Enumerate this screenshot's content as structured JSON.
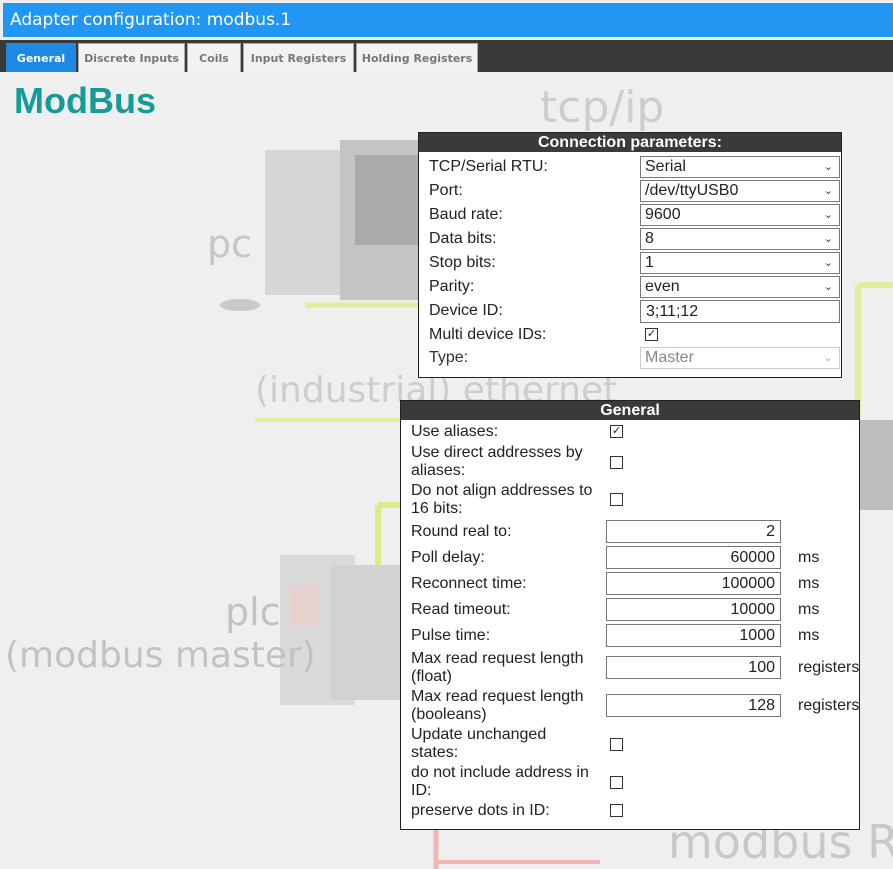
{
  "window": {
    "title": "Adapter configuration: modbus.1"
  },
  "tabs": [
    {
      "label": "General",
      "active": true
    },
    {
      "label": "Discrete Inputs",
      "active": false
    },
    {
      "label": "Coils",
      "active": false
    },
    {
      "label": "Input Registers",
      "active": false
    },
    {
      "label": "Holding Registers",
      "active": false
    }
  ],
  "brand": "ModBus",
  "background_labels": {
    "tcpip": "tcp/ip",
    "pc": "pc",
    "ethernet": "(industrial) ethernet",
    "plc": "plc",
    "master": "(modbus master)",
    "slave_partial": "modbus R"
  },
  "connection": {
    "title": "Connection parameters:",
    "tcp_serial": {
      "label": "TCP/Serial RTU:",
      "value": "Serial"
    },
    "port": {
      "label": "Port:",
      "value": "/dev/ttyUSB0"
    },
    "baud": {
      "label": "Baud rate:",
      "value": "9600"
    },
    "data_bits": {
      "label": "Data bits:",
      "value": "8"
    },
    "stop_bits": {
      "label": "Stop bits:",
      "value": "1"
    },
    "parity": {
      "label": "Parity:",
      "value": "even"
    },
    "device_id": {
      "label": "Device ID:",
      "value": "3;11;12"
    },
    "multi_ids": {
      "label": "Multi device IDs:",
      "checked": true
    },
    "type": {
      "label": "Type:",
      "value": "Master"
    }
  },
  "general": {
    "title": "General",
    "use_aliases": {
      "label": "Use aliases:",
      "checked": true
    },
    "direct_addresses": {
      "label1": "Use direct addresses by",
      "label2": "aliases:",
      "checked": false
    },
    "no_align": {
      "label1": "Do not align addresses to",
      "label2": "16 bits:",
      "checked": false
    },
    "round_real": {
      "label": "Round real to:",
      "value": "2"
    },
    "poll_delay": {
      "label": "Poll delay:",
      "value": "60000",
      "unit": "ms"
    },
    "reconnect": {
      "label": "Reconnect time:",
      "value": "100000",
      "unit": "ms"
    },
    "read_timeout": {
      "label": "Read timeout:",
      "value": "10000",
      "unit": "ms"
    },
    "pulse": {
      "label": "Pulse time:",
      "value": "1000",
      "unit": "ms"
    },
    "max_float": {
      "label1": "Max read request length",
      "label2": "(float)",
      "value": "100",
      "unit": "registers"
    },
    "max_bool": {
      "label1": "Max read request length",
      "label2": "(booleans)",
      "value": "128",
      "unit": "registers"
    },
    "update_unchanged": {
      "label1": "Update unchanged",
      "label2": "states:",
      "checked": false
    },
    "no_address_id": {
      "label1": "do not include address in",
      "label2": "ID:",
      "checked": false
    },
    "preserve_dots": {
      "label": "preserve dots in ID:",
      "checked": false
    }
  },
  "icons": {
    "dropdown": "chevron-down-icon",
    "check": "checkmark-icon"
  },
  "colors": {
    "titlebar": "#2196f3",
    "brand": "#179b97",
    "tab_active": "#1e88e5",
    "panel_header": "#3a3a3a"
  }
}
